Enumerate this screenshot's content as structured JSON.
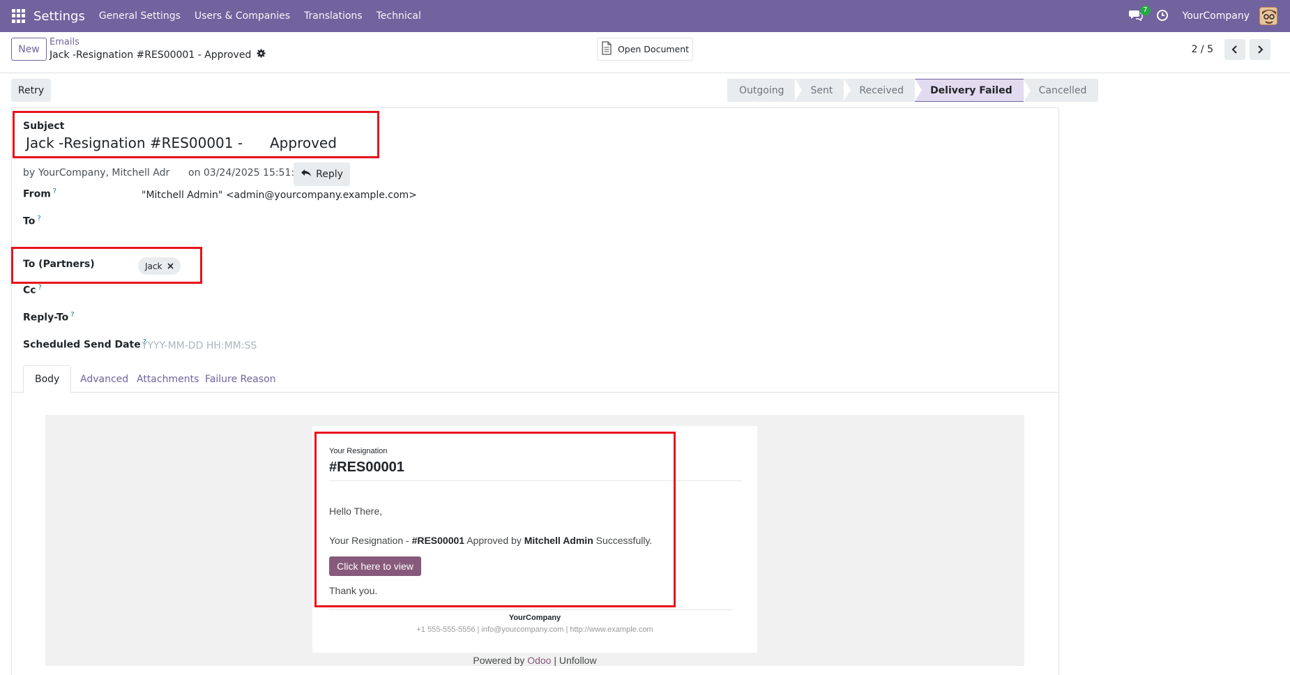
{
  "navbar": {
    "app_name": "Settings",
    "menu": [
      "General Settings",
      "Users & Companies",
      "Translations",
      "Technical"
    ],
    "chat_count": "7",
    "company": "YourCompany",
    "bg_color": "#71639e"
  },
  "control": {
    "new_label": "New",
    "breadcrumb_parent": "Emails",
    "breadcrumb_current": "Jack -Resignation #RES00001 - Approved",
    "open_document_label": "Open Document",
    "pager": "2 / 5"
  },
  "actions": {
    "retry_label": "Retry"
  },
  "statusbar": {
    "stages": [
      "Outgoing",
      "Sent",
      "Received",
      "Delivery Failed",
      "Cancelled"
    ],
    "active_index": 3
  },
  "form": {
    "subject_label": "Subject",
    "subject_value_part1": "Jack -Resignation #RES00001 -",
    "subject_value_part2": "Approved",
    "author_prefix": "by",
    "author": "YourCompany, Mitchell Adr",
    "date": "on 03/24/2025 15:51:24",
    "reply_label": "Reply",
    "from_label": "From",
    "from_value": "\"Mitchell Admin\" <admin@yourcompany.example.com>",
    "to_label": "To",
    "to_partners_label": "To (Partners)",
    "partner_tag": "Jack",
    "cc_label": "Cc",
    "reply_to_label": "Reply-To",
    "scheduled_label": "Scheduled Send Date",
    "scheduled_placeholder": "YYYY-MM-DD HH:MM:SS",
    "help_mark": "?"
  },
  "tabs": [
    "Body",
    "Advanced",
    "Attachments",
    "Failure Reason"
  ],
  "mail": {
    "header_small": "Your Resignation",
    "reference": "#RES00001",
    "greeting": "Hello There,",
    "line_prefix": "Your Resignation -",
    "line_ref": "#RES00001",
    "line_mid": "Approved by",
    "line_user": "Mitchell Admin",
    "line_suffix": "Successfully.",
    "button_label": "Click here to view",
    "closing": "Thank you.",
    "footer_company": "YourCompany",
    "footer_contact": "+1 555-555-5556 | info@yourcompany.com | http://www.example.com",
    "powered_prefix": "Powered by",
    "powered_brand": "Odoo",
    "powered_sep": "|",
    "unfollow": "Unfollow"
  }
}
